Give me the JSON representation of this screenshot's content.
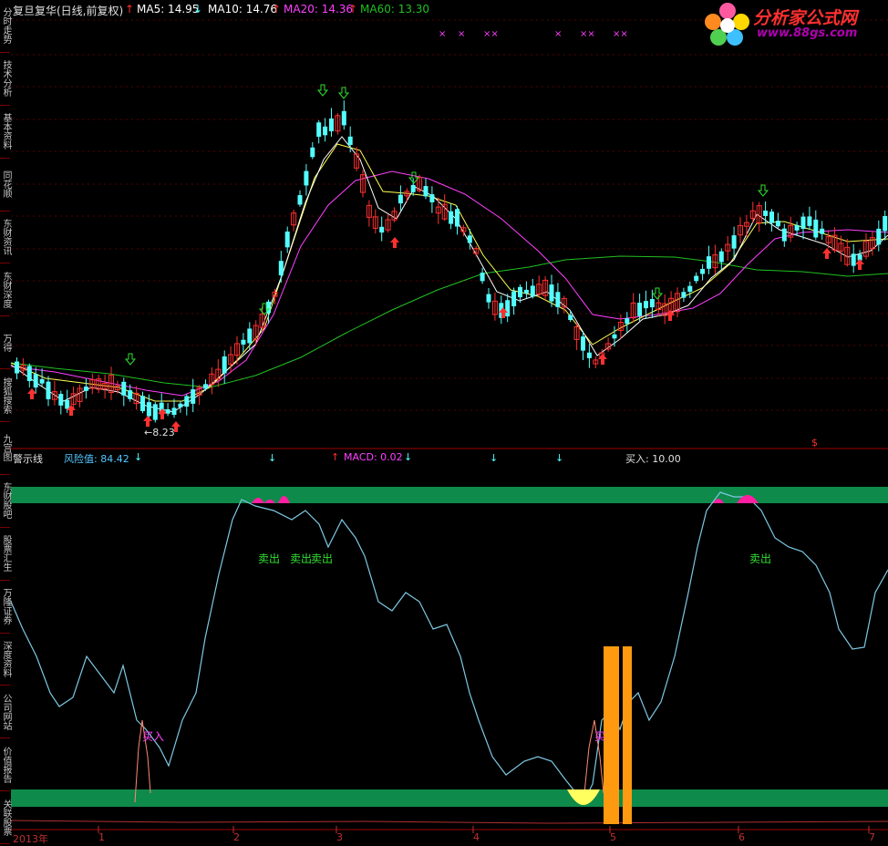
{
  "header": {
    "stock_title": "复旦复华(日线,前复权)",
    "ma5": "MA5: 14.95",
    "ma10": "MA10: 14.76",
    "ma20": "MA20: 14.36",
    "ma60": "MA60: 13.30",
    "ma5_arrow": "↑",
    "ma10_arrow": "↓",
    "ma20_arrow": "↑",
    "ma60_arrow": "↑"
  },
  "logo": {
    "text": "分析家公式网",
    "url_text": "www.88gs.com"
  },
  "sidebar_tabs": [
    "分时走势",
    "技术分析",
    "基本资料",
    "同花顺",
    "东财资讯",
    "东财深度",
    "万得",
    "搜狐搜索",
    "九宫图",
    "东财股吧",
    "股票汇生",
    "万隆证券",
    "深度资料",
    "公司网站",
    "价值报告",
    "关联股票"
  ],
  "indicator_header": {
    "name": "警示线",
    "risk_label": "风险值: 84.42",
    "macd_label": "MACD: 0.02",
    "buy_label": "买入: 10.00"
  },
  "annotations": {
    "low_price": "8.23",
    "dollar": "$",
    "x_marks": [
      "×",
      "×",
      "××",
      "×",
      "××",
      "××"
    ],
    "sell_labels": [
      "卖出",
      "卖出",
      "卖出",
      "卖出"
    ],
    "buy_labels": [
      "买入",
      "买"
    ]
  },
  "x_axis": {
    "labels": [
      "2013年",
      "1",
      "2",
      "3",
      "4",
      "5",
      "6",
      "7"
    ]
  },
  "colors": {
    "up": "#ff3030",
    "down": "#54ffff",
    "ma5": "#ffffff",
    "ma10": "#ffff50",
    "ma20": "#ff40ff",
    "ma60": "#20c020",
    "band": "#0e8a4a",
    "indicator_line": "#7ec8e3",
    "bar": "#ff9a10",
    "pink": "#ff1fa0"
  },
  "chart_data": [
    {
      "type": "candlestick",
      "title": "复旦复华(日线,前复权)",
      "series": [
        {
          "name": "MA5",
          "value": 14.95
        },
        {
          "name": "MA10",
          "value": 14.76
        },
        {
          "name": "MA20",
          "value": 14.36
        },
        {
          "name": "MA60",
          "value": 13.3
        }
      ],
      "annotations": [
        "8.23"
      ],
      "x_tick_labels": [
        "2013年",
        "1",
        "2",
        "3",
        "4",
        "5",
        "6",
        "7"
      ]
    },
    {
      "type": "line",
      "title": "警示线",
      "series": [
        {
          "name": "风险值",
          "value": 84.42
        },
        {
          "name": "MACD",
          "value": 0.02
        },
        {
          "name": "买入",
          "value": 10.0
        }
      ],
      "labels": [
        "卖出",
        "卖出",
        "卖出",
        "卖出",
        "买入"
      ]
    }
  ]
}
